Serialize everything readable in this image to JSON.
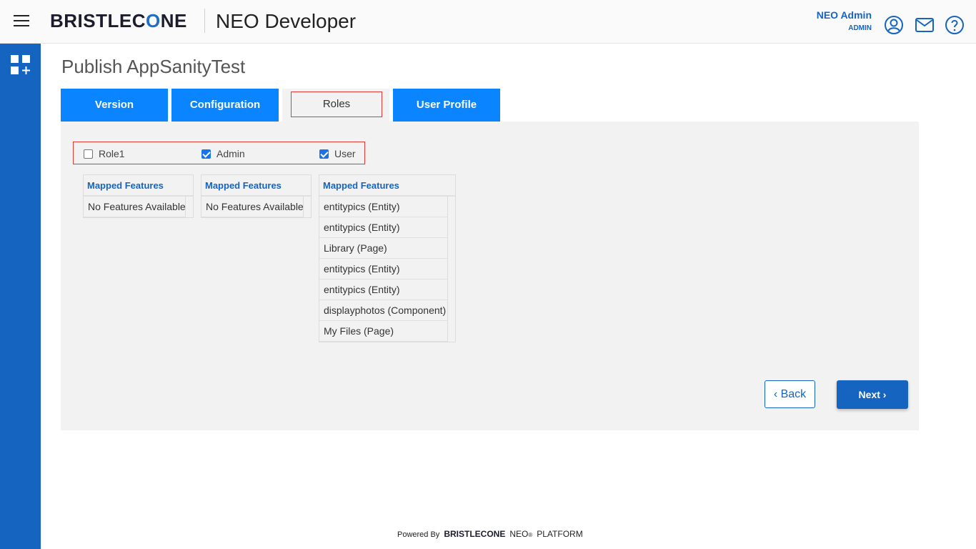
{
  "header": {
    "brand_text": "BRISTLEC",
    "brand_o": "O",
    "brand_tail": "NE",
    "app_title": "NEO Developer",
    "user_name": "NEO Admin",
    "user_role": "ADMIN",
    "icons": [
      "user-circle-icon",
      "mail-icon",
      "help-icon"
    ]
  },
  "page": {
    "title": "Publish AppSanityTest"
  },
  "tabs": [
    {
      "label": "Version",
      "active": false
    },
    {
      "label": "Configuration",
      "active": false
    },
    {
      "label": "Roles",
      "active": true
    },
    {
      "label": "User Profile",
      "active": false
    }
  ],
  "roles": [
    {
      "label": "Role1",
      "checked": false
    },
    {
      "label": "Admin",
      "checked": true
    },
    {
      "label": "User",
      "checked": true
    }
  ],
  "features": [
    {
      "header": "Mapped Features",
      "rows": [
        "No Features Available"
      ]
    },
    {
      "header": "Mapped Features",
      "rows": [
        "No Features Available"
      ]
    },
    {
      "header": "Mapped Features",
      "rows": [
        "entitypics (Entity)",
        "entitypics (Entity)",
        "Library (Page)",
        "entitypics (Entity)",
        "entitypics (Entity)",
        "displayphotos (Component)",
        "My Files (Page)"
      ]
    }
  ],
  "buttons": {
    "back": "‹ Back",
    "next": "Next ›"
  },
  "footer": {
    "powered_by": "Powered By",
    "brand": "BRISTLECONE",
    "neo": "NEO",
    "reg": "®",
    "platform": "PLATFORM"
  },
  "colors": {
    "primary": "#1565c0",
    "tab_blue": "#0a84ff",
    "highlight_red": "#e53935",
    "panel_bg": "#f2f2f2"
  }
}
